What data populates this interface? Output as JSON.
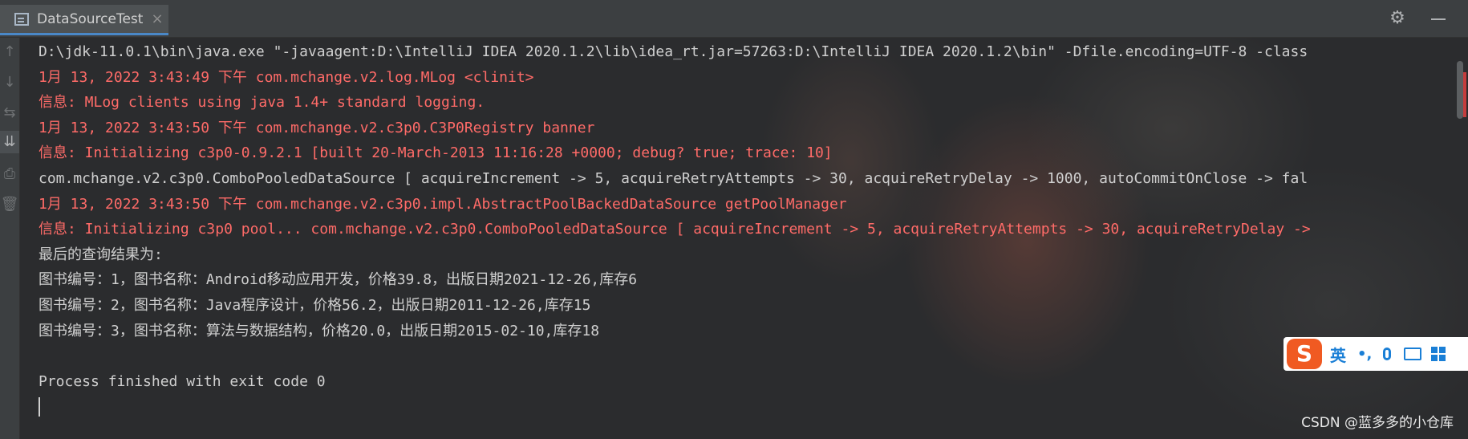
{
  "tab": {
    "title": "DataSourceTest",
    "close_symbol": "×",
    "icon": "console-icon"
  },
  "header_icons": [
    "gear-icon",
    "minimize-icon"
  ],
  "toolbar": {
    "items": [
      {
        "name": "up-arrow-icon",
        "glyph": "↑"
      },
      {
        "name": "down-arrow-icon",
        "glyph": "↓"
      },
      {
        "name": "soft-wrap-icon",
        "glyph": "⇆"
      },
      {
        "name": "scroll-to-end-icon",
        "glyph": "⇊"
      },
      {
        "name": "print-icon",
        "glyph": "⎙"
      },
      {
        "name": "trash-icon",
        "glyph": "🗑"
      }
    ]
  },
  "console": {
    "lines": [
      {
        "type": "out",
        "text": "D:\\jdk-11.0.1\\bin\\java.exe \"-javaagent:D:\\IntelliJ IDEA 2020.1.2\\lib\\idea_rt.jar=57263:D:\\IntelliJ IDEA 2020.1.2\\bin\" -Dfile.encoding=UTF-8 -class"
      },
      {
        "type": "err",
        "text": "1月 13, 2022 3:43:49 下午 com.mchange.v2.log.MLog <clinit>"
      },
      {
        "type": "err",
        "text": "信息: MLog clients using java 1.4+ standard logging."
      },
      {
        "type": "err",
        "text": "1月 13, 2022 3:43:50 下午 com.mchange.v2.c3p0.C3P0Registry banner"
      },
      {
        "type": "err",
        "text": "信息: Initializing c3p0-0.9.2.1 [built 20-March-2013 11:16:28 +0000; debug? true; trace: 10]"
      },
      {
        "type": "out",
        "text": "com.mchange.v2.c3p0.ComboPooledDataSource [ acquireIncrement -> 5, acquireRetryAttempts -> 30, acquireRetryDelay -> 1000, autoCommitOnClose -> fal"
      },
      {
        "type": "err",
        "text": "1月 13, 2022 3:43:50 下午 com.mchange.v2.c3p0.impl.AbstractPoolBackedDataSource getPoolManager"
      },
      {
        "type": "err",
        "text": "信息: Initializing c3p0 pool... com.mchange.v2.c3p0.ComboPooledDataSource [ acquireIncrement -> 5, acquireRetryAttempts -> 30, acquireRetryDelay ->"
      },
      {
        "type": "out",
        "text": "最后的查询结果为:"
      },
      {
        "type": "out",
        "text": "图书编号：1，图书名称：Android移动应用开发，价格39.8，出版日期2021-12-26,库存6"
      },
      {
        "type": "out",
        "text": "图书编号：2，图书名称：Java程序设计，价格56.2，出版日期2011-12-26,库存15"
      },
      {
        "type": "out",
        "text": "图书编号：3，图书名称：算法与数据结构，价格20.0，出版日期2015-02-10,库存18"
      },
      {
        "type": "out",
        "text": ""
      },
      {
        "type": "out",
        "text": "Process finished with exit code 0"
      }
    ]
  },
  "ime": {
    "logo": "S",
    "lang": "英",
    "punct": "•,",
    "icons": [
      "microphone-icon",
      "keyboard-icon",
      "grid-icon"
    ]
  },
  "watermark": "CSDN @蓝多多的小仓库",
  "colors": {
    "error_text": "#ff6b68",
    "normal_text": "#cfcfcf",
    "background": "#2b2c2e",
    "ime_logo": "#f05a22",
    "ime_accent": "#1a7fd6"
  }
}
